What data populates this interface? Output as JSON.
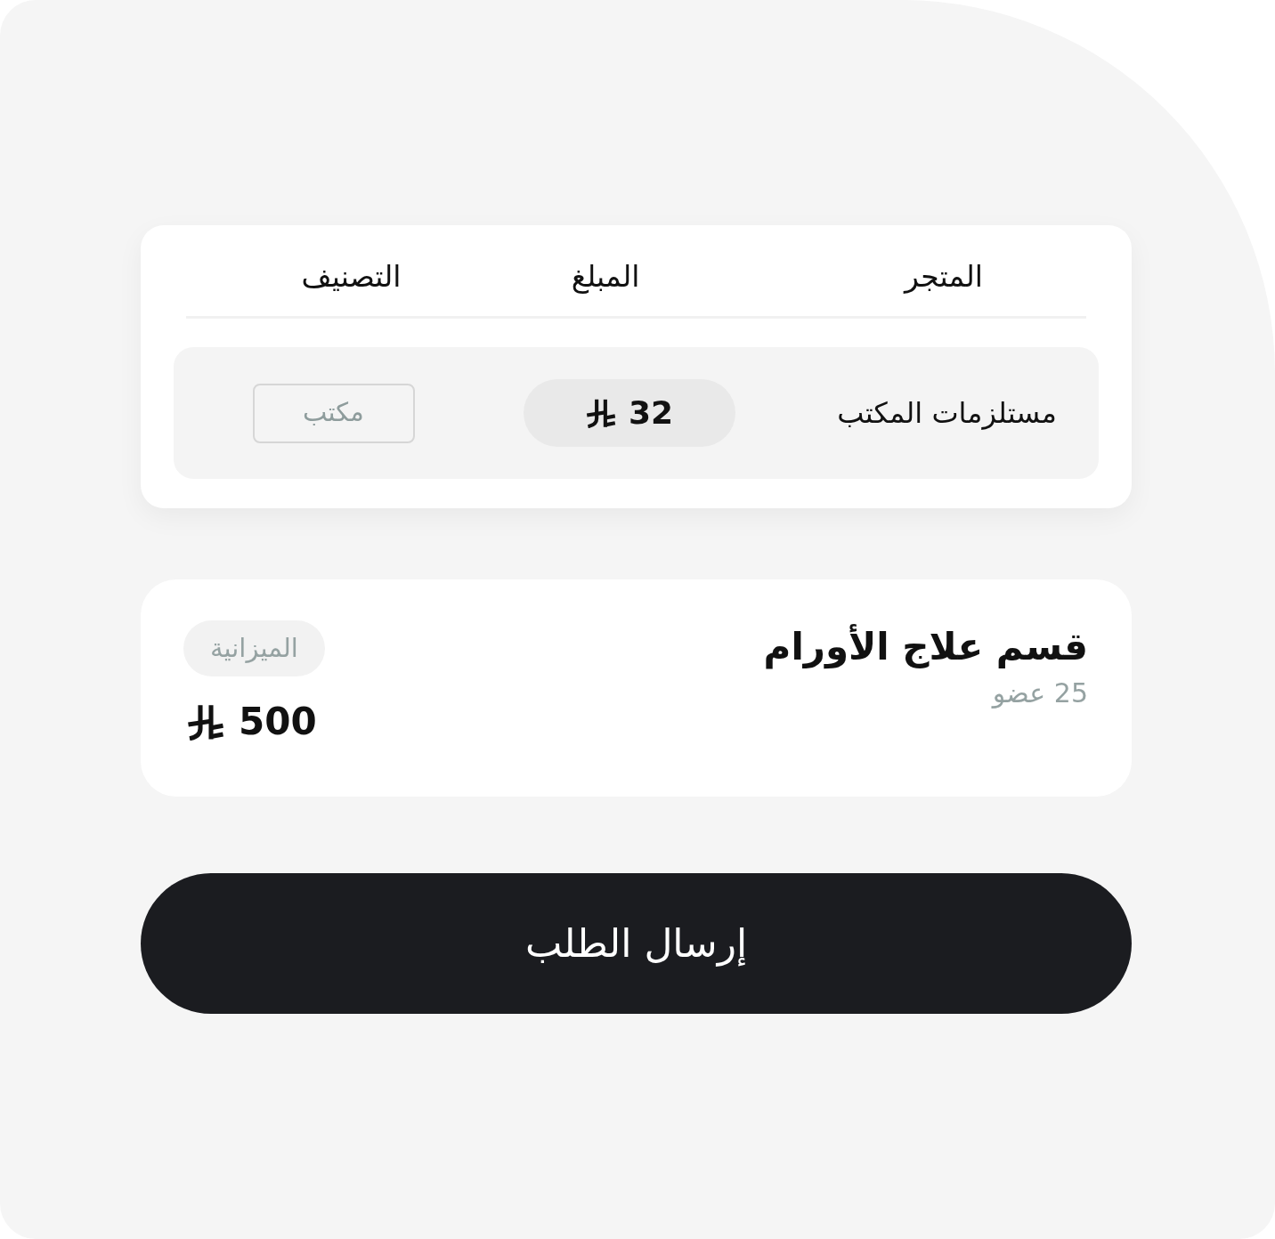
{
  "table": {
    "columns": [
      "المتجر",
      "المبلغ",
      "التصنيف"
    ],
    "rows": [
      {
        "store": "مستلزمات المكتب",
        "amount": "32",
        "category": "مكتب"
      }
    ]
  },
  "department_card": {
    "title": "قسم علاج الأورام",
    "members": "25 عضو",
    "budget_label": "الميزانية",
    "budget_amount": "500"
  },
  "submit_button": {
    "label": "إرسال الطلب"
  }
}
